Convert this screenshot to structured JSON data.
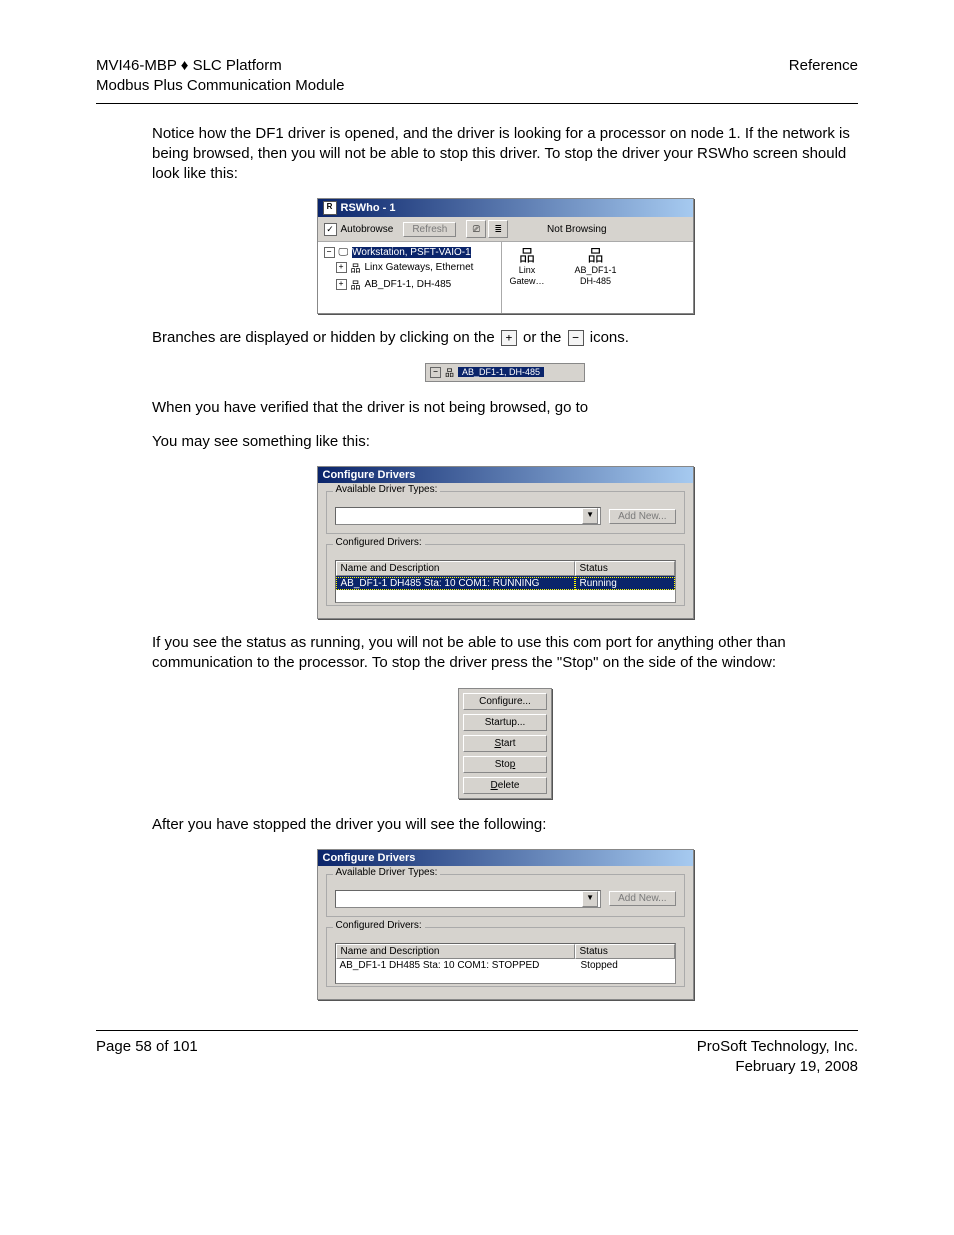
{
  "header": {
    "left1": "MVI46-MBP ♦ SLC Platform",
    "left2": "Modbus Plus Communication Module",
    "right": "Reference"
  },
  "paragraphs": {
    "p1": "Notice how the DF1 driver is opened, and the driver is looking for a processor on node 1. If the network is being browsed, then you will not be able to stop this driver. To stop the driver your RSWho screen should look like this:",
    "p2a": "Branches are displayed or hidden by clicking on the ",
    "p2b": " or the ",
    "p2c": " icons.",
    "p3": "When you have verified that the driver is not being browsed, go to",
    "p4": "You may see something like this:",
    "p5": "If you see the status as running, you will not be able to use this com port for anything other than communication to the processor. To stop the driver press the \"Stop\" on the side of the window:",
    "p6": "After you have stopped the driver you will see the following:"
  },
  "rswho": {
    "title": "RSWho - 1",
    "autobrowse": "Autobrowse",
    "refresh": "Refresh",
    "status": "Not Browsing",
    "tree": {
      "root": "Workstation, PSFT-VAIO-1",
      "n1": "Linx Gateways, Ethernet",
      "n2": "AB_DF1-1, DH-485"
    },
    "dev1a": "Linx",
    "dev1b": "Gatew…",
    "dev2a": "AB_DF1-1",
    "dev2b": "DH-485"
  },
  "tree_strip": "AB_DF1-1, DH-485",
  "cfg": {
    "title": "Configure Drivers",
    "avail": "Available Driver Types:",
    "addnew": "Add New...",
    "configured": "Configured Drivers:",
    "col_name": "Name and Description",
    "col_status": "Status",
    "running_row": "AB_DF1-1 DH485 Sta: 10 COM1: RUNNING",
    "running_status": "Running",
    "stopped_row": "AB_DF1-1 DH485 Sta: 10 COM1: STOPPED",
    "stopped_status": "Stopped"
  },
  "btns": {
    "configure": "Configure...",
    "startup": "Startup...",
    "start": "Start",
    "stop": "Stop",
    "delete": "Delete"
  },
  "footer": {
    "left": "Page 58 of 101",
    "r1": "ProSoft Technology, Inc.",
    "r2": "February 19, 2008"
  }
}
